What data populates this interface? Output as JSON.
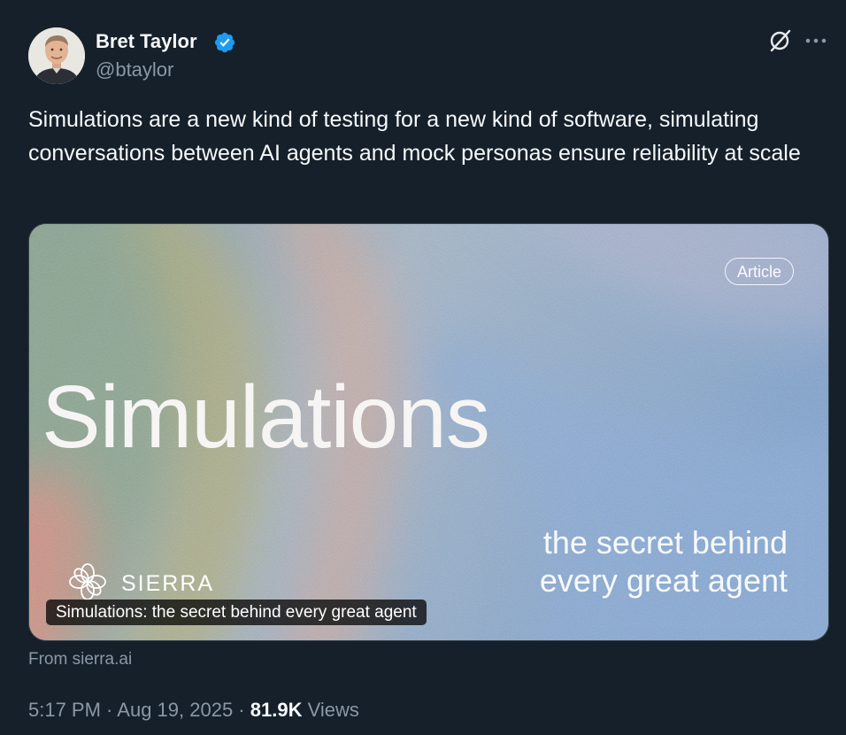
{
  "author": {
    "display_name": "Bret Taylor",
    "handle": "@btaylor",
    "verified": true,
    "avatar_icon": "profile-photo"
  },
  "actions": {
    "grok_icon": "grok-icon",
    "more_icon": "more-icon"
  },
  "tweet": {
    "text": "Simulations are a new kind of testing for a new kind of software, simulating conversations between AI agents and mock personas ensure reliability at scale"
  },
  "card": {
    "badge": "Article",
    "headline": "Simulations",
    "tagline_line1": "the secret behind",
    "tagline_line2": "every great agent",
    "brand": "SIERRA",
    "caption": "Simulations: the secret behind every great agent",
    "source": "From sierra.ai"
  },
  "meta": {
    "time": "5:17 PM",
    "separator1": " · ",
    "date": "Aug 19, 2025",
    "separator2": " · ",
    "views_count": "81.9K",
    "views_label": " Views"
  },
  "colors": {
    "background": "#15202b",
    "text_primary": "#f7f9f9",
    "text_secondary": "#8b98a5",
    "verified": "#1d9bf0"
  }
}
